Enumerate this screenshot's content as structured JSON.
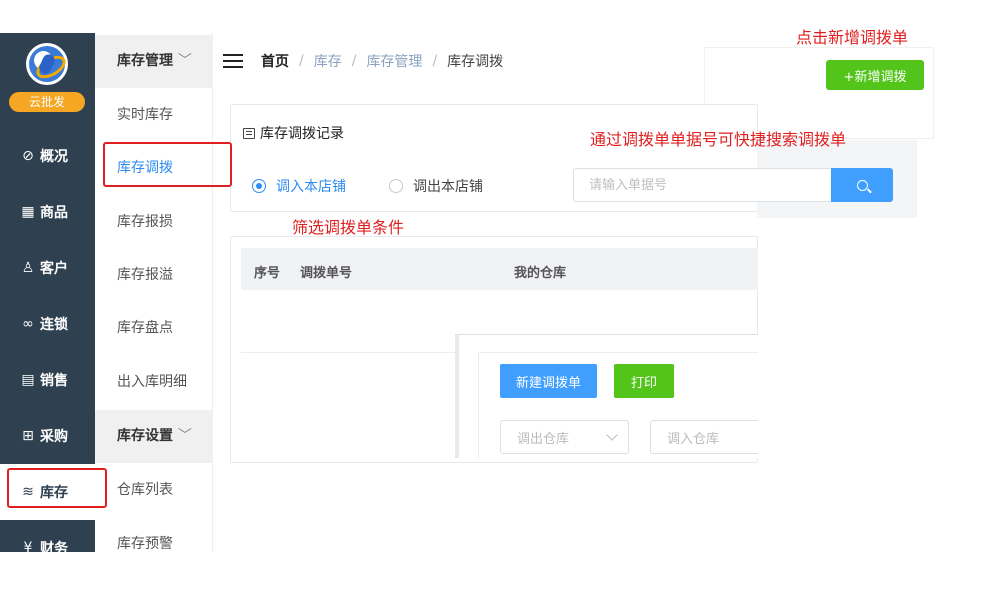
{
  "app": {
    "logo_text": "云批发"
  },
  "sidebar": {
    "items": [
      {
        "icon": "compass-icon",
        "glyph": "⊘",
        "label": "概况"
      },
      {
        "icon": "grid-icon",
        "glyph": "▦",
        "label": "商品"
      },
      {
        "icon": "user-icon",
        "glyph": "♙",
        "label": "客户"
      },
      {
        "icon": "link-icon",
        "glyph": "∞",
        "label": "连锁"
      },
      {
        "icon": "clipboard-icon",
        "glyph": "▤",
        "label": "销售"
      },
      {
        "icon": "basket-icon",
        "glyph": "⊞",
        "label": "采购"
      },
      {
        "icon": "stack-icon",
        "glyph": "≋",
        "label": "库存"
      },
      {
        "icon": "yen-icon",
        "glyph": "¥",
        "label": "财务"
      }
    ]
  },
  "submenu": {
    "group1": "库存管理",
    "items1": [
      "实时库存",
      "库存调拨",
      "库存报损",
      "库存报溢",
      "库存盘点",
      "出入库明细"
    ],
    "group2": "库存设置",
    "items2": [
      "仓库列表",
      "库存预警"
    ]
  },
  "header": {
    "breadcrumb": {
      "home": "首页",
      "level1": "库存",
      "level2": "库存管理",
      "current": "库存调拨"
    },
    "add_button": "+新增调拨"
  },
  "records": {
    "title": "库存调拨记录",
    "radio_in": "调入本店铺",
    "radio_out": "调出本店铺",
    "search_placeholder": "请输入单据号"
  },
  "table": {
    "col_index": "序号",
    "col_number": "调拨单号",
    "col_warehouse": "我的仓库"
  },
  "dialog": {
    "new_button": "新建调拨单",
    "print_button": "打印",
    "select_out": "调出仓库",
    "select_in": "调入仓库"
  },
  "annotations": {
    "add_hint": "点击新增调拨单",
    "search_hint": "通过调拨单单据号可快捷搜索调拨单",
    "filter_hint": "筛选调拨单条件"
  },
  "colors": {
    "sidebar": "#2f4050",
    "primary": "#409eff",
    "success": "#52c41a",
    "annotation": "#e02020"
  }
}
